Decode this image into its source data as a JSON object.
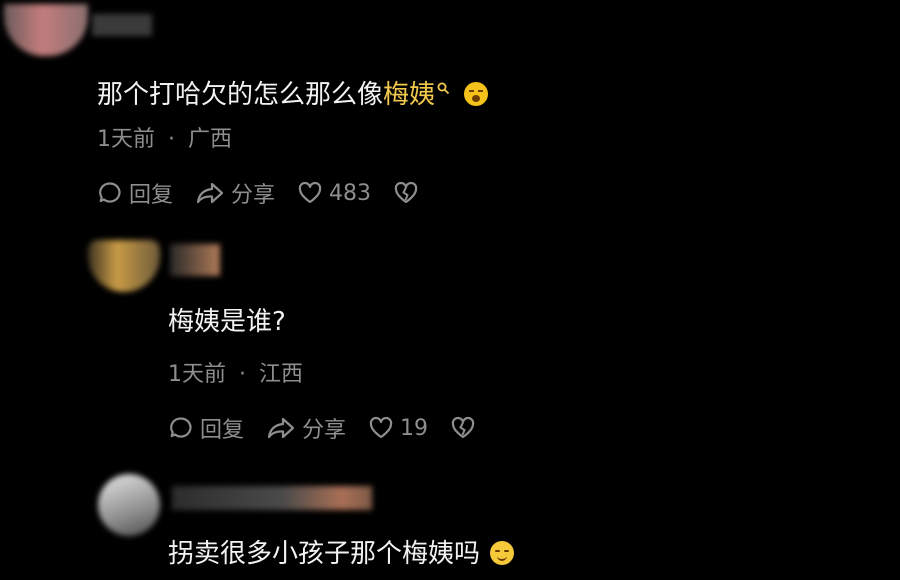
{
  "comments": [
    {
      "text_prefix": "那个打哈欠的怎么那么像",
      "highlight": "梅姨",
      "time": "1天前",
      "separator": "·",
      "location": "广西",
      "actions": {
        "reply": "回复",
        "share": "分享",
        "likes": "483"
      }
    },
    {
      "text": "梅姨是谁?",
      "time": "1天前",
      "separator": "·",
      "location": "江西",
      "actions": {
        "reply": "回复",
        "share": "分享",
        "likes": "19"
      }
    },
    {
      "text": "拐卖很多小孩子那个梅姨吗"
    }
  ],
  "colors": {
    "background": "#000000",
    "highlight": "#f2c94c",
    "meta": "#8e8e8e",
    "text": "#f2f2f2"
  },
  "icons": [
    "search-icon",
    "yawn-emoji-icon",
    "reply-icon",
    "share-icon",
    "like-icon",
    "dislike-icon",
    "smile-emoji-icon"
  ]
}
